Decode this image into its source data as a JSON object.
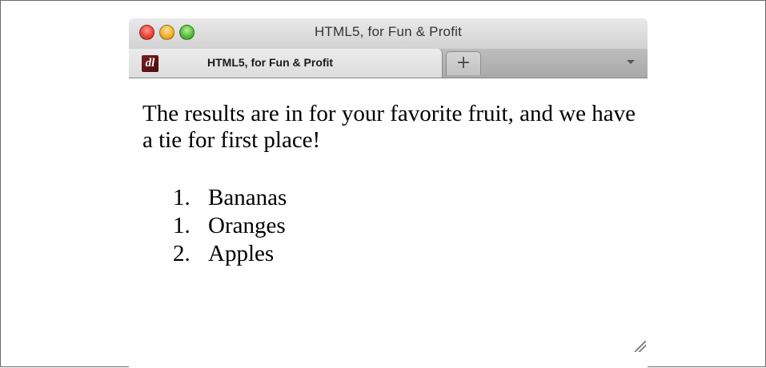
{
  "window": {
    "title": "HTML5, for Fun & Profit"
  },
  "tabs": [
    {
      "label": "HTML5, for Fun & Profit",
      "favicon": "dl"
    }
  ],
  "new_tab_label": "+",
  "content": {
    "intro": "The results are in for your favorite fruit, and we have a tie for first place!",
    "list": [
      {
        "number": "1.",
        "text": "Bananas"
      },
      {
        "number": "1.",
        "text": "Oranges"
      },
      {
        "number": "2.",
        "text": "Apples"
      }
    ]
  },
  "colors": {
    "close": "#e8453a",
    "minimize": "#f3b12e",
    "zoom": "#53be3b",
    "favicon": "#7b1f1f"
  }
}
